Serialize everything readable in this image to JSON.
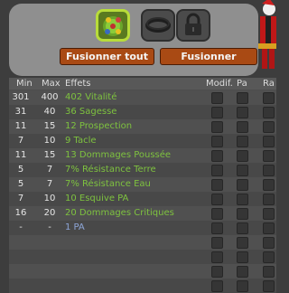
{
  "toolbar": {
    "slots": [
      "creature-icon",
      "ring-icon",
      "lock-icon"
    ],
    "fusion_all_label": "Fusionner tout",
    "fusion_label": "Fusionner"
  },
  "table": {
    "headers": {
      "min": "Min",
      "max": "Max",
      "effects": "Effets",
      "modif": "Modif.",
      "pa": "Pa",
      "ra": "Ra"
    },
    "rows": [
      {
        "min": "301",
        "max": "400",
        "effect": "402 Vitalité",
        "color": "green"
      },
      {
        "min": "31",
        "max": "40",
        "effect": "36 Sagesse",
        "color": "green"
      },
      {
        "min": "11",
        "max": "15",
        "effect": "12 Prospection",
        "color": "green"
      },
      {
        "min": "7",
        "max": "10",
        "effect": "9 Tacle",
        "color": "green"
      },
      {
        "min": "11",
        "max": "15",
        "effect": "13 Dommages Poussée",
        "color": "green"
      },
      {
        "min": "5",
        "max": "7",
        "effect": "7% Résistance Terre",
        "color": "green"
      },
      {
        "min": "5",
        "max": "7",
        "effect": "7% Résistance Eau",
        "color": "green"
      },
      {
        "min": "7",
        "max": "10",
        "effect": "10 Esquive PA",
        "color": "green"
      },
      {
        "min": "16",
        "max": "20",
        "effect": "20 Dommages Critiques",
        "color": "green"
      },
      {
        "min": "-",
        "max": "-",
        "effect": "1 PA",
        "color": "blue"
      },
      {
        "min": "",
        "max": "",
        "effect": "",
        "color": ""
      },
      {
        "min": "",
        "max": "",
        "effect": "",
        "color": ""
      },
      {
        "min": "",
        "max": "",
        "effect": "",
        "color": ""
      },
      {
        "min": "",
        "max": "",
        "effect": "",
        "color": ""
      }
    ]
  }
}
